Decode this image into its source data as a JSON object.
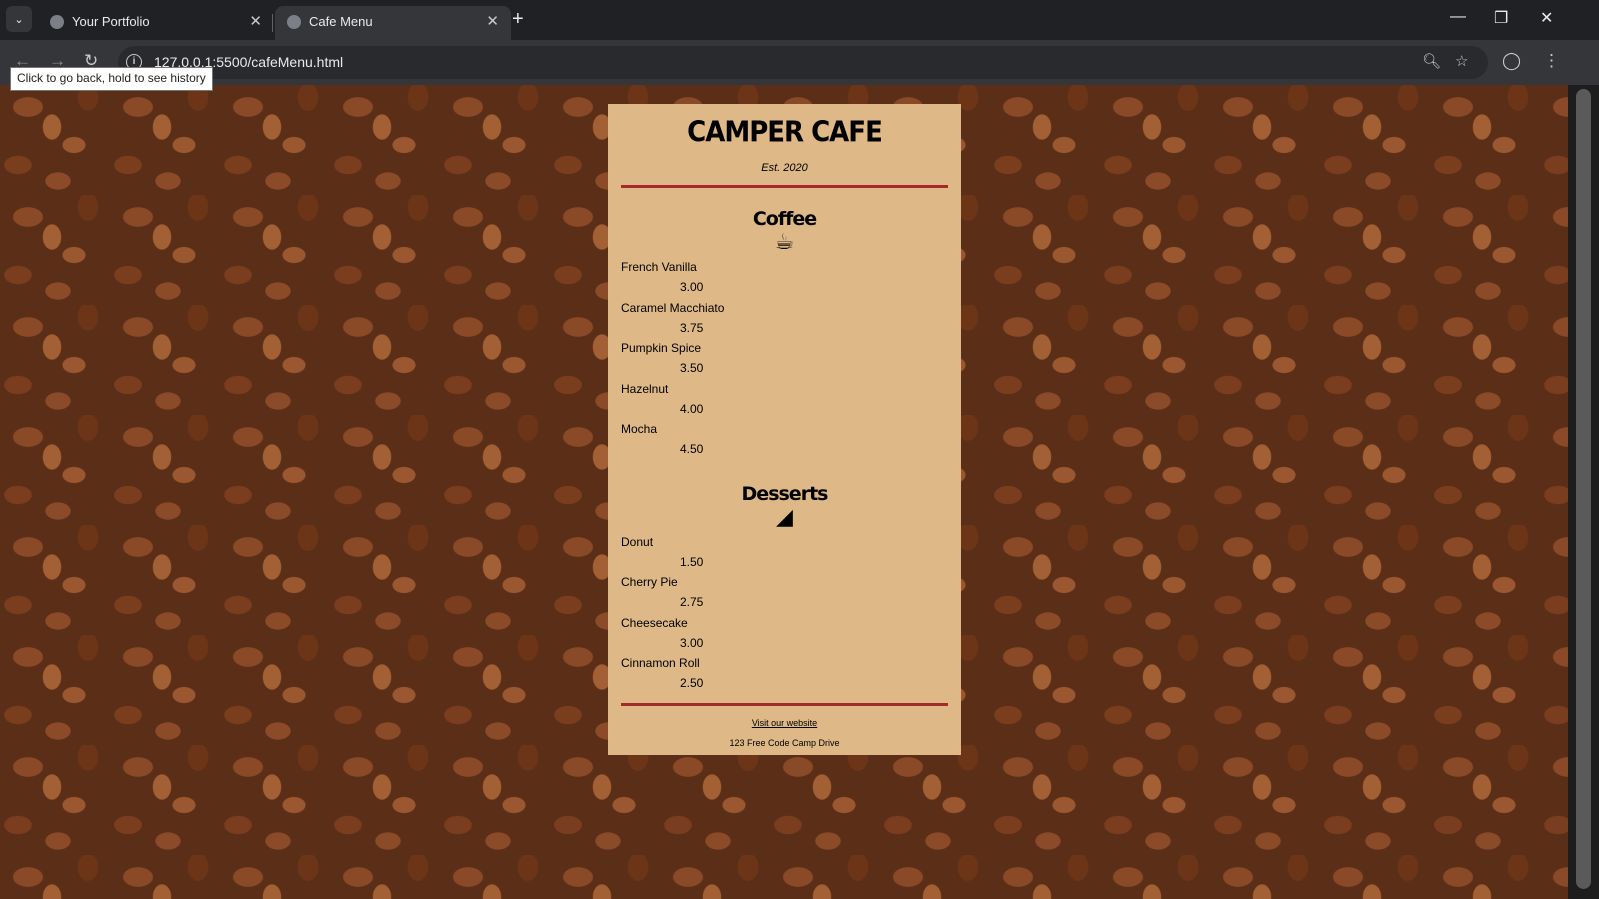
{
  "browser": {
    "tabs": [
      {
        "title": "Your Portfolio",
        "active": false
      },
      {
        "title": "Cafe Menu",
        "active": true
      }
    ],
    "url": "127.0.0.1:5500/cafeMenu.html",
    "tooltip": "Click to go back, hold to see history"
  },
  "menu": {
    "cafe_name": "CAMPER CAFE",
    "established": "Est. 2020",
    "coffee": {
      "title": "Coffee",
      "icon": "coffee-cup-icon",
      "items": [
        {
          "flavor": "French Vanilla",
          "price": "3.00"
        },
        {
          "flavor": "Caramel Macchiato",
          "price": "3.75"
        },
        {
          "flavor": "Pumpkin Spice",
          "price": "3.50"
        },
        {
          "flavor": "Hazelnut",
          "price": "4.00"
        },
        {
          "flavor": "Mocha",
          "price": "4.50"
        }
      ]
    },
    "desserts": {
      "title": "Desserts",
      "icon": "pie-slice-icon",
      "items": [
        {
          "flavor": "Donut",
          "price": "1.50"
        },
        {
          "flavor": "Cherry Pie",
          "price": "2.75"
        },
        {
          "flavor": "Cheesecake",
          "price": "3.00"
        },
        {
          "flavor": "Cinnamon Roll",
          "price": "2.50"
        }
      ]
    },
    "footer": {
      "link": "Visit our website",
      "address": "123 Free Code Camp Drive"
    }
  },
  "colors": {
    "card": "#deb887",
    "divider": "#a52a2a",
    "chrome": "#202124"
  }
}
